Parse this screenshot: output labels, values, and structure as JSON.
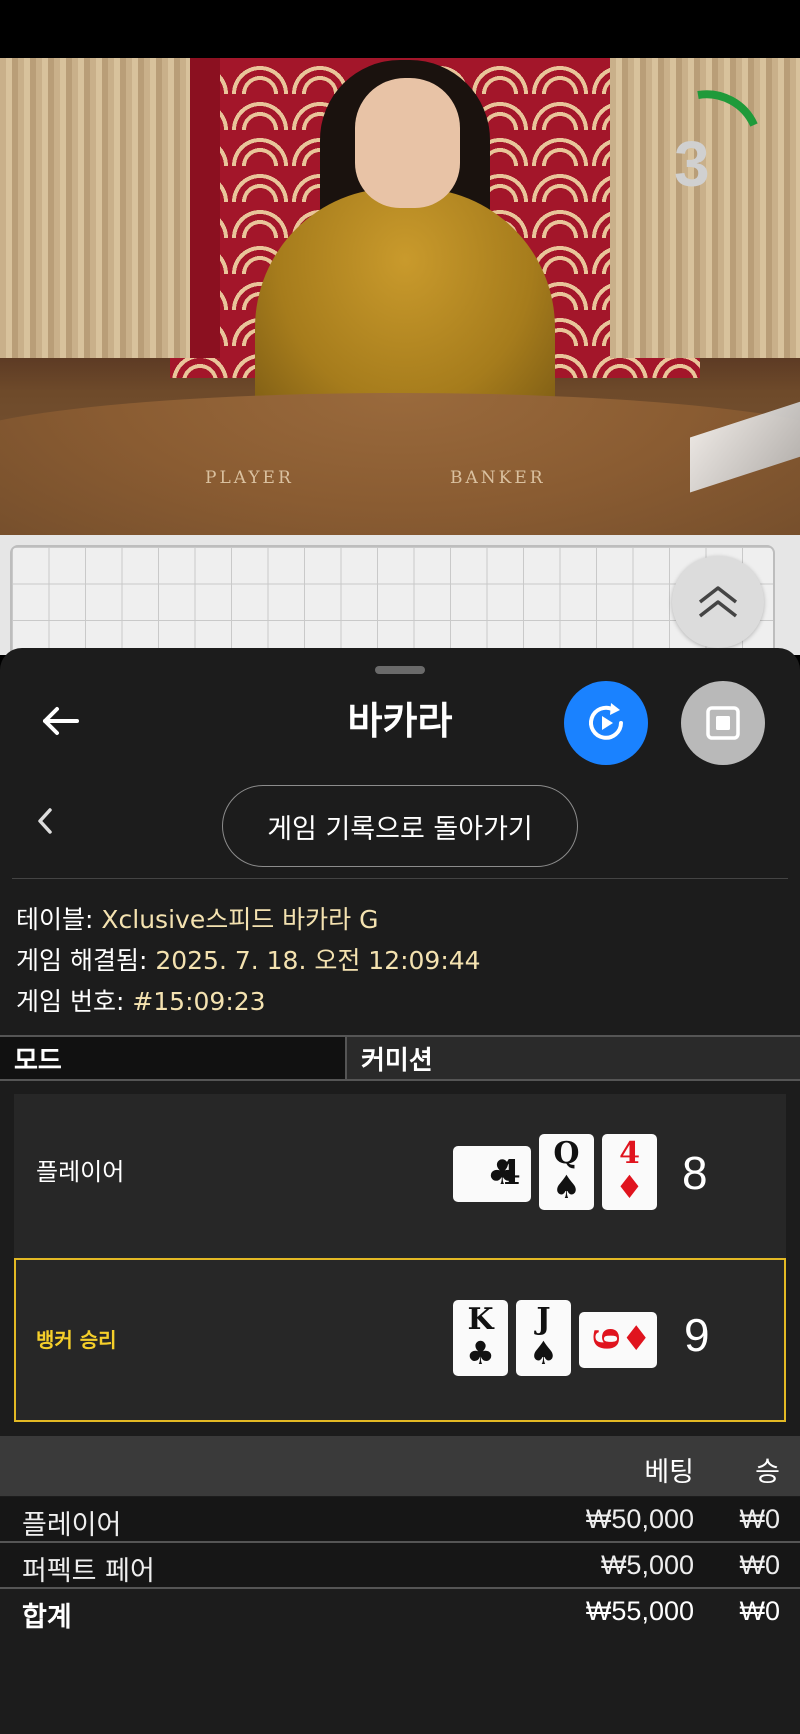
{
  "video": {
    "countdown": "3",
    "table_labels": {
      "player": "PLAYER",
      "banker": "BANKER"
    }
  },
  "header": {
    "title": "바카라"
  },
  "history_button": {
    "label": "게임 기록으로 돌아가기"
  },
  "info": {
    "table_label": "테이블:",
    "table_value": "Xclusive스피드 바카라 G",
    "resolved_label": "게임 해결됨:",
    "resolved_value": "2025. 7. 18. 오전 12:09:44",
    "number_label": "게임 번호:",
    "number_value": "#15:09:23"
  },
  "tabs": [
    {
      "label": "모드"
    },
    {
      "label": "커미션"
    }
  ],
  "hands": {
    "player": {
      "label": "플레이어",
      "score": "8",
      "cards": [
        {
          "rank": "4",
          "suit": "♣",
          "color": "black",
          "orientation": "sideways"
        },
        {
          "rank": "Q",
          "suit": "♠",
          "color": "black",
          "orientation": "upright"
        },
        {
          "rank": "4",
          "suit": "♦",
          "color": "red",
          "orientation": "upright"
        }
      ]
    },
    "banker": {
      "label": "뱅커 승리",
      "score": "9",
      "cards": [
        {
          "rank": "K",
          "suit": "♣",
          "color": "black",
          "orientation": "upright"
        },
        {
          "rank": "J",
          "suit": "♠",
          "color": "black",
          "orientation": "upright"
        },
        {
          "rank": "9",
          "suit": "♦",
          "color": "red",
          "orientation": "sideways"
        }
      ]
    }
  },
  "bets": {
    "header": {
      "bet": "베팅",
      "win": "승"
    },
    "rows": [
      {
        "name": "플레이어",
        "bet": "₩50,000",
        "win": "₩0"
      },
      {
        "name": "퍼펙트 페어",
        "bet": "₩5,000",
        "win": "₩0"
      }
    ],
    "total": {
      "name": "합계",
      "bet": "₩55,000",
      "win": "₩0"
    }
  },
  "colors": {
    "accent_blue": "#1a82ff",
    "winner_highlight": "#e3b924",
    "info_value": "#f4e2b0",
    "countdown_arc": "#1f9a3a",
    "panel_bg": "#1c1c1c"
  },
  "icons": {
    "back": "arrow-left-icon",
    "replay": "replay-icon",
    "stop": "stop-icon",
    "collapse": "double-chevron-up-icon",
    "history_back": "chevron-left-icon"
  }
}
